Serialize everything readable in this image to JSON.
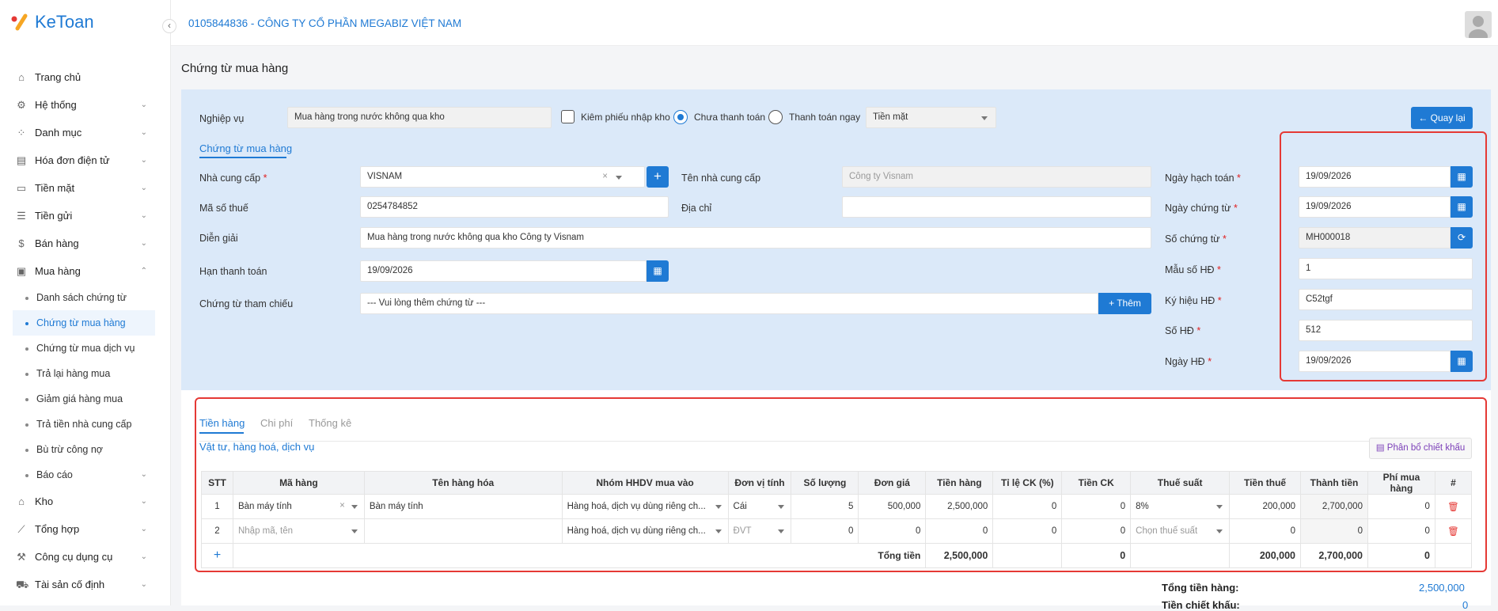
{
  "app": {
    "logo_text": "KeToan"
  },
  "company": "0105844836 - CÔNG TY CỔ PHẦN MEGABIZ VIỆT NAM",
  "sidebar": {
    "items": [
      {
        "label": "Trang chủ",
        "icon": "home-icon"
      },
      {
        "label": "Hệ thống",
        "icon": "gear-icon"
      },
      {
        "label": "Danh mục",
        "icon": "grid-icon"
      },
      {
        "label": "Hóa đơn điện tử",
        "icon": "invoice-icon"
      },
      {
        "label": "Tiền mặt",
        "icon": "cash-icon"
      },
      {
        "label": "Tiền gửi",
        "icon": "bank-icon"
      },
      {
        "label": "Bán hàng",
        "icon": "sales-icon"
      },
      {
        "label": "Mua hàng",
        "icon": "cart-icon"
      }
    ],
    "sub": [
      "Danh sách chứng từ",
      "Chứng từ mua hàng",
      "Chứng từ mua dịch vụ",
      "Trả lại hàng mua",
      "Giảm giá hàng mua",
      "Trả tiền nhà cung cấp",
      "Bù trừ công nợ",
      "Báo cáo"
    ],
    "items2": [
      {
        "label": "Kho",
        "icon": "warehouse-icon"
      },
      {
        "label": "Tổng hợp",
        "icon": "chart-icon"
      },
      {
        "label": "Công cụ dụng cụ",
        "icon": "tools-icon"
      },
      {
        "label": "Tài sản cố định",
        "icon": "car-icon"
      }
    ]
  },
  "page_title": "Chứng từ mua hàng",
  "form": {
    "nghiep_vu_label": "Nghiệp vụ",
    "nghiep_vu_value": "Mua hàng trong nước không qua kho",
    "kiem_phieu": "Kiêm phiếu nhập kho",
    "chua_thanh_toan": "Chưa thanh toán",
    "thanh_toan_ngay": "Thanh toán ngay",
    "payment_method": "Tiền mặt",
    "back_button": "Quay lại",
    "tab": "Chứng từ mua hàng",
    "ncc_label": "Nhà cung cấp",
    "ncc_value": "VISNAM",
    "ten_ncc_label": "Tên nhà cung cấp",
    "ten_ncc_value": "Công ty Visnam",
    "mst_label": "Mã số thuế",
    "mst_value": "0254784852",
    "dia_chi_label": "Địa chỉ",
    "dia_chi_value": "",
    "dien_giai_label": "Diễn giải",
    "dien_giai_value": "Mua hàng trong nước không qua kho Công ty Visnam",
    "han_tt_label": "Hạn thanh toán",
    "han_tt_value": "19/09/2026",
    "ref_label": "Chứng từ tham chiếu",
    "ref_placeholder": "--- Vui lòng thêm chứng từ ---",
    "them_button": "Thêm",
    "right": [
      {
        "label": "Ngày hạch toán",
        "value": "19/09/2026",
        "btn": "calendar-icon"
      },
      {
        "label": "Ngày chứng từ",
        "value": "19/09/2026",
        "btn": "calendar-icon"
      },
      {
        "label": "Số chứng từ",
        "value": "MH000018",
        "btn": "refresh-icon"
      },
      {
        "label": "Mẫu số HĐ",
        "value": "1"
      },
      {
        "label": "Ký hiệu HĐ",
        "value": "C52tgf"
      },
      {
        "label": "Số HĐ",
        "value": "512"
      },
      {
        "label": "Ngày HĐ",
        "value": "19/09/2026",
        "btn": "calendar-icon"
      }
    ]
  },
  "lower": {
    "tabs": [
      "Tiền hàng",
      "Chi phí",
      "Thống kê"
    ],
    "section_title": "Vật tư, hàng hoá, dịch vụ",
    "phan_bo_button": "Phân bổ chiết khấu",
    "columns": [
      "STT",
      "Mã hàng",
      "Tên hàng hóa",
      "Nhóm HHDV mua vào",
      "Đơn vị tính",
      "Số lượng",
      "Đơn giá",
      "Tiền hàng",
      "Tỉ lệ CK (%)",
      "Tiền CK",
      "Thuế suất",
      "Tiền thuế",
      "Thành tiền",
      "Phí mua hàng",
      "#"
    ],
    "rows": [
      {
        "stt": "1",
        "ma": "Bàn máy tính",
        "ten": "Bàn máy tính",
        "nhom": "Hàng hoá, dịch vụ dùng riêng ch...",
        "dvt": "Cái",
        "sl": "5",
        "dg": "500,000",
        "tien": "2,500,000",
        "tl": "0",
        "ck": "0",
        "thue": "8%",
        "tienthue": "200,000",
        "thanhtien": "2,700,000",
        "phi": "0"
      },
      {
        "stt": "2",
        "ma": "Nhập mã, tên",
        "ten": "",
        "nhom": "Hàng hoá, dịch vụ dùng riêng ch...",
        "dvt": "ĐVT",
        "sl": "0",
        "dg": "0",
        "tien": "0",
        "tl": "0",
        "ck": "0",
        "thue": "Chọn thuế suất",
        "tienthue": "0",
        "thanhtien": "0",
        "phi": "0"
      }
    ],
    "total_label": "Tổng tiền",
    "total_tien": "2,500,000",
    "total_ck": "0",
    "total_thue": "200,000",
    "total_thanhtien": "2,700,000",
    "total_phi": "0",
    "summary_label": "Tổng tiền hàng:",
    "summary_value": "2,500,000",
    "summary2_label": "Tiền chiết khấu:",
    "summary2_value": "0"
  }
}
